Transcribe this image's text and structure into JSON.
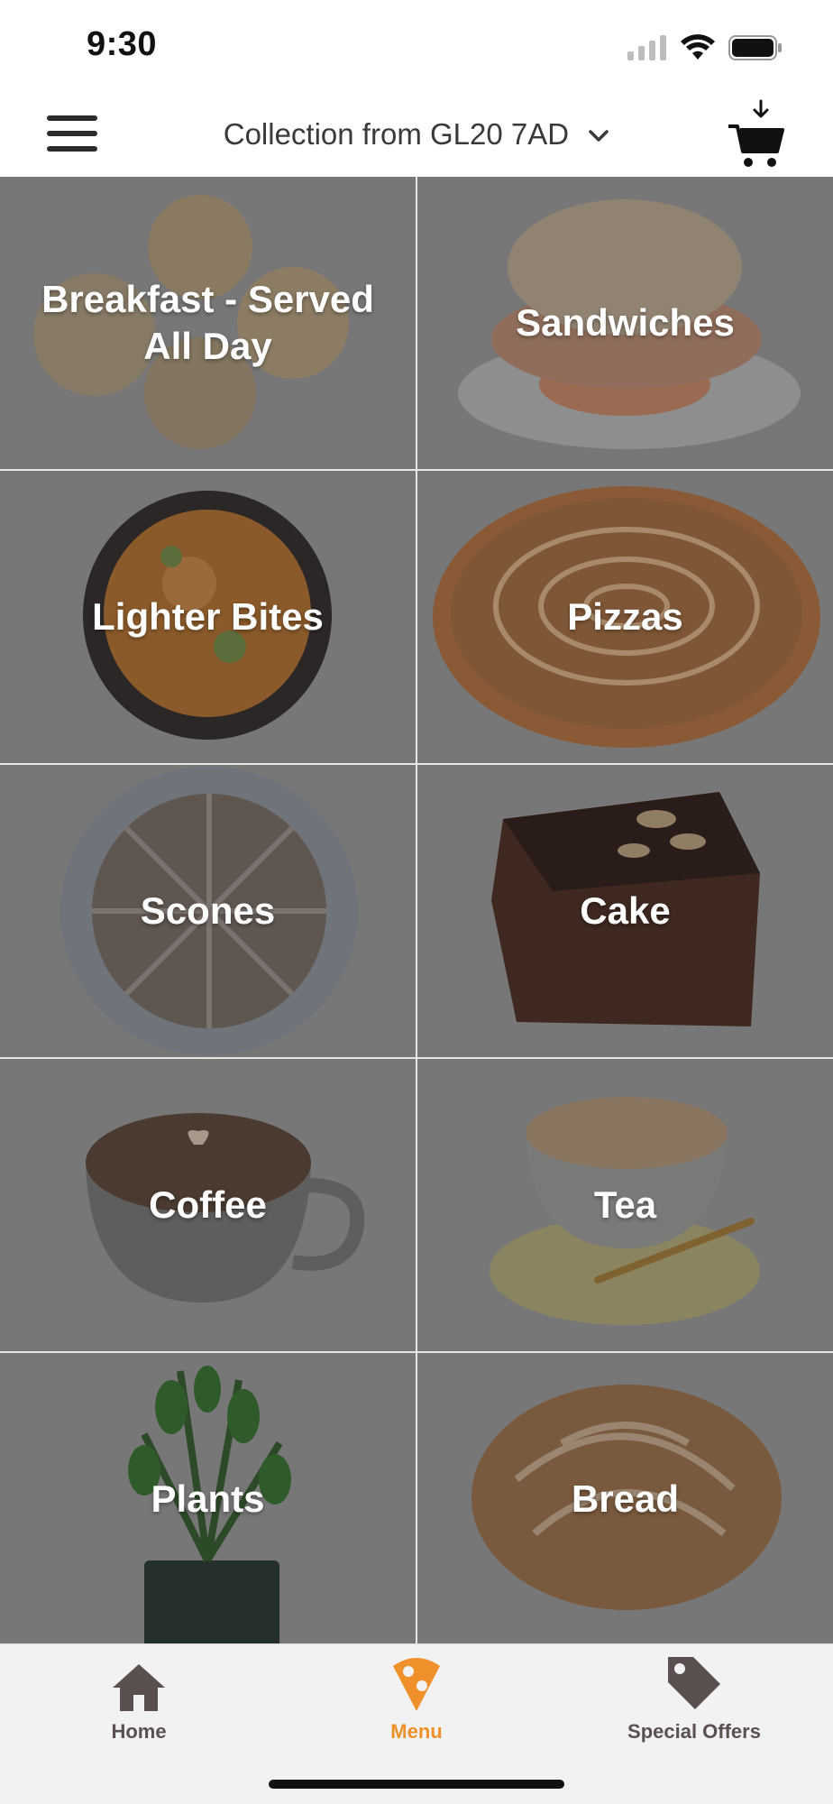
{
  "status_bar": {
    "time": "9:30"
  },
  "header": {
    "location_label": "Collection from GL20 7AD"
  },
  "categories": [
    {
      "label": "Breakfast - Served All Day"
    },
    {
      "label": "Sandwiches"
    },
    {
      "label": "Lighter Bites"
    },
    {
      "label": "Pizzas"
    },
    {
      "label": "Scones"
    },
    {
      "label": "Cake"
    },
    {
      "label": "Coffee"
    },
    {
      "label": "Tea"
    },
    {
      "label": "Plants"
    },
    {
      "label": "Bread"
    }
  ],
  "tabbar": {
    "active_tab": "Menu",
    "tabs": [
      {
        "label": "Home",
        "icon": "home-icon"
      },
      {
        "label": "Menu",
        "icon": "menu-pin-icon"
      },
      {
        "label": "Special Offers",
        "icon": "tag-icon"
      }
    ]
  },
  "colors": {
    "accent": "#F0902A",
    "tab_inactive": "#5b5050",
    "tile_overlay": "#777777"
  }
}
